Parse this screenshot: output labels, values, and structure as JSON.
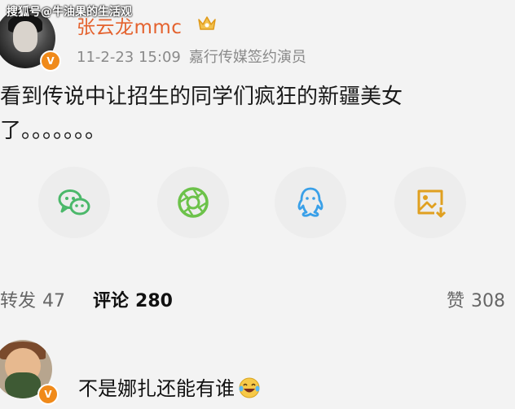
{
  "watermark": "搜狐号@牛油果的生活观",
  "post": {
    "username": "张云龙mmc",
    "date": "11-2-23 15:09",
    "source": "嘉行传媒签约演员",
    "badge": "V",
    "text_line1": "看到传说中让招生的同学们疯狂的新疆美女",
    "text_line2": "了。。。。。。。"
  },
  "share": {
    "icons": [
      "wechat-icon",
      "moments-icon",
      "qq-icon",
      "save-image-icon"
    ],
    "colors": {
      "wechat": "#4bb86a",
      "moments": "#6cc24a",
      "qq": "#3aa0e8",
      "save": "#e0a020"
    }
  },
  "actions": {
    "repost_label": "转发",
    "repost_count": "47",
    "comment_label": "评论",
    "comment_count": "280",
    "like_label": "赞",
    "like_count": "308"
  },
  "comment": {
    "text": "不是娜扎还能有谁",
    "badge": "V",
    "emoji": "laughing-tears-emoji"
  },
  "colors": {
    "username": "#e4622e",
    "meta": "#8a8a8a",
    "badge": "#f08a1a"
  }
}
